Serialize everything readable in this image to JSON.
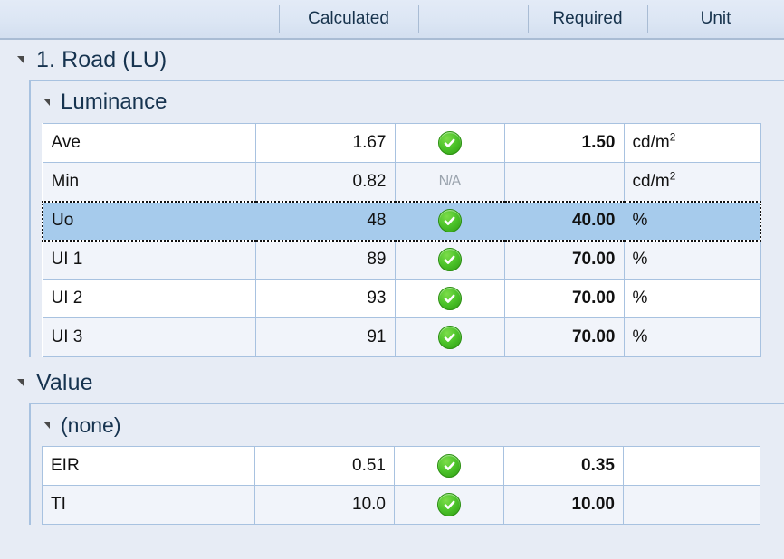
{
  "header": {
    "columns": [
      {
        "key": "name",
        "label": ""
      },
      {
        "key": "calculated",
        "label": "Calculated"
      },
      {
        "key": "status",
        "label": ""
      },
      {
        "key": "required",
        "label": "Required"
      },
      {
        "key": "unit",
        "label": "Unit"
      }
    ]
  },
  "groups": {
    "road": {
      "title": "1. Road (LU)",
      "expander": "expanded-triangle-icon",
      "subgroups": {
        "luminance": {
          "title": "Luminance",
          "expander": "expanded-triangle-icon",
          "rows": [
            {
              "name": "Ave",
              "calculated": "1.67",
              "status": "ok",
              "required": "1.50",
              "unit": "cd/m",
              "unit_sup": "2",
              "selected": false
            },
            {
              "name": "Min",
              "calculated": "0.82",
              "status": "na",
              "required": "",
              "unit": "cd/m",
              "unit_sup": "2",
              "selected": false
            },
            {
              "name": "Uo",
              "calculated": "48",
              "status": "ok",
              "required": "40.00",
              "unit": "%",
              "unit_sup": "",
              "selected": true
            },
            {
              "name": "UI 1",
              "calculated": "89",
              "status": "ok",
              "required": "70.00",
              "unit": "%",
              "unit_sup": "",
              "selected": false
            },
            {
              "name": "UI 2",
              "calculated": "93",
              "status": "ok",
              "required": "70.00",
              "unit": "%",
              "unit_sup": "",
              "selected": false
            },
            {
              "name": "UI 3",
              "calculated": "91",
              "status": "ok",
              "required": "70.00",
              "unit": "%",
              "unit_sup": "",
              "selected": false
            }
          ]
        }
      }
    },
    "value": {
      "title": "Value",
      "expander": "expanded-triangle-icon",
      "subgroups": {
        "none": {
          "title": "(none)",
          "expander": "expanded-triangle-icon",
          "rows": [
            {
              "name": "EIR",
              "calculated": "0.51",
              "status": "ok",
              "required": "0.35",
              "unit": "",
              "unit_sup": "",
              "selected": false
            },
            {
              "name": "TI",
              "calculated": "10.0",
              "status": "ok",
              "required": "10.00",
              "unit": "",
              "unit_sup": "",
              "selected": false
            }
          ]
        }
      }
    }
  },
  "icons": {
    "ok": "green-check-circle-icon",
    "na": "not-applicable-icon",
    "na_text": "N/A"
  },
  "colors": {
    "background": "#e7ecf5",
    "header_gradient_top": "#e3ebf7",
    "header_gradient_bottom": "#d3dff0",
    "grid_border": "#a8c2e0",
    "row_alt": "#f1f4fa",
    "row_base": "#ffffff",
    "selection": "#a6cbec",
    "text": "#16334f",
    "status_ok": "#4cc32a",
    "status_na": "#9aa3ad"
  }
}
